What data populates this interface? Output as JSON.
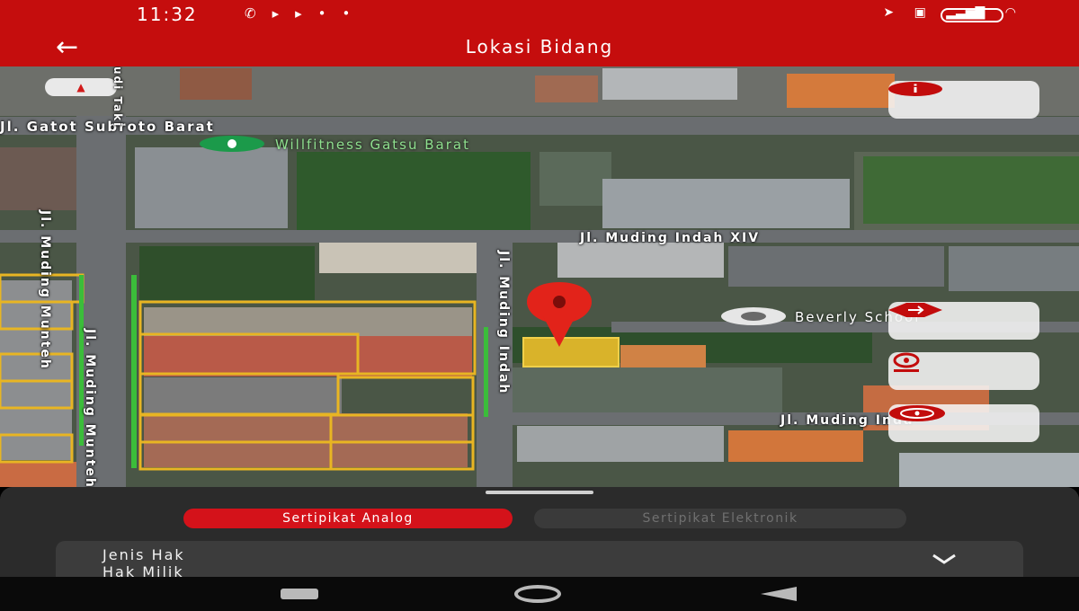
{
  "status_bar": {
    "time": "11:32",
    "left_icons": [
      "whatsapp-icon",
      "play-icon",
      "play-icon",
      "more-dots-icon"
    ],
    "right_icons": [
      "location-arrow-icon",
      "volte-icon",
      "signal-icon",
      "wifi-icon"
    ],
    "battery": "69"
  },
  "app_bar": {
    "title": "Lokasi Bidang",
    "back_icon": "←"
  },
  "map": {
    "roads": {
      "gatot_subroto": "Jl. Gatot Subroto Barat",
      "muding_indah_xiv": "Jl. Muding Indah XIV",
      "muding_munteh_upper": "Jl. Muding Munteh",
      "muding_munteh_lower": "Jl. Muding Munteh",
      "muding_indah_vertical": "Jl. Muding Indah",
      "muding_indah_lower": "Jl. Muding Inda",
      "top_vertical": "udi Taki"
    },
    "pois": {
      "willfitness": "Willfitness Gatsu Barat",
      "beverly": "Beverly School"
    },
    "buttons": [
      "info-icon",
      "swap-arrows-icon",
      "location-pin-icon",
      "target-icon"
    ],
    "marker": "location-pin-icon",
    "colors": {
      "parcel_outline": "#e8b523",
      "highlight_parcel": "#d9b32a",
      "marker": "#e2231a",
      "accent": "#c50d0d"
    }
  },
  "sheet": {
    "tabs": [
      "Sertipikat Analog",
      "Sertipikat Elektronik"
    ],
    "active_tab": "Sertipikat Analog",
    "card": {
      "label": "Jenis Hak",
      "value": "Hak Milik",
      "chevron": "chevron-down-icon"
    }
  },
  "nav_bar": {
    "buttons": [
      "recents-icon",
      "home-icon",
      "back-triangle-icon"
    ]
  }
}
